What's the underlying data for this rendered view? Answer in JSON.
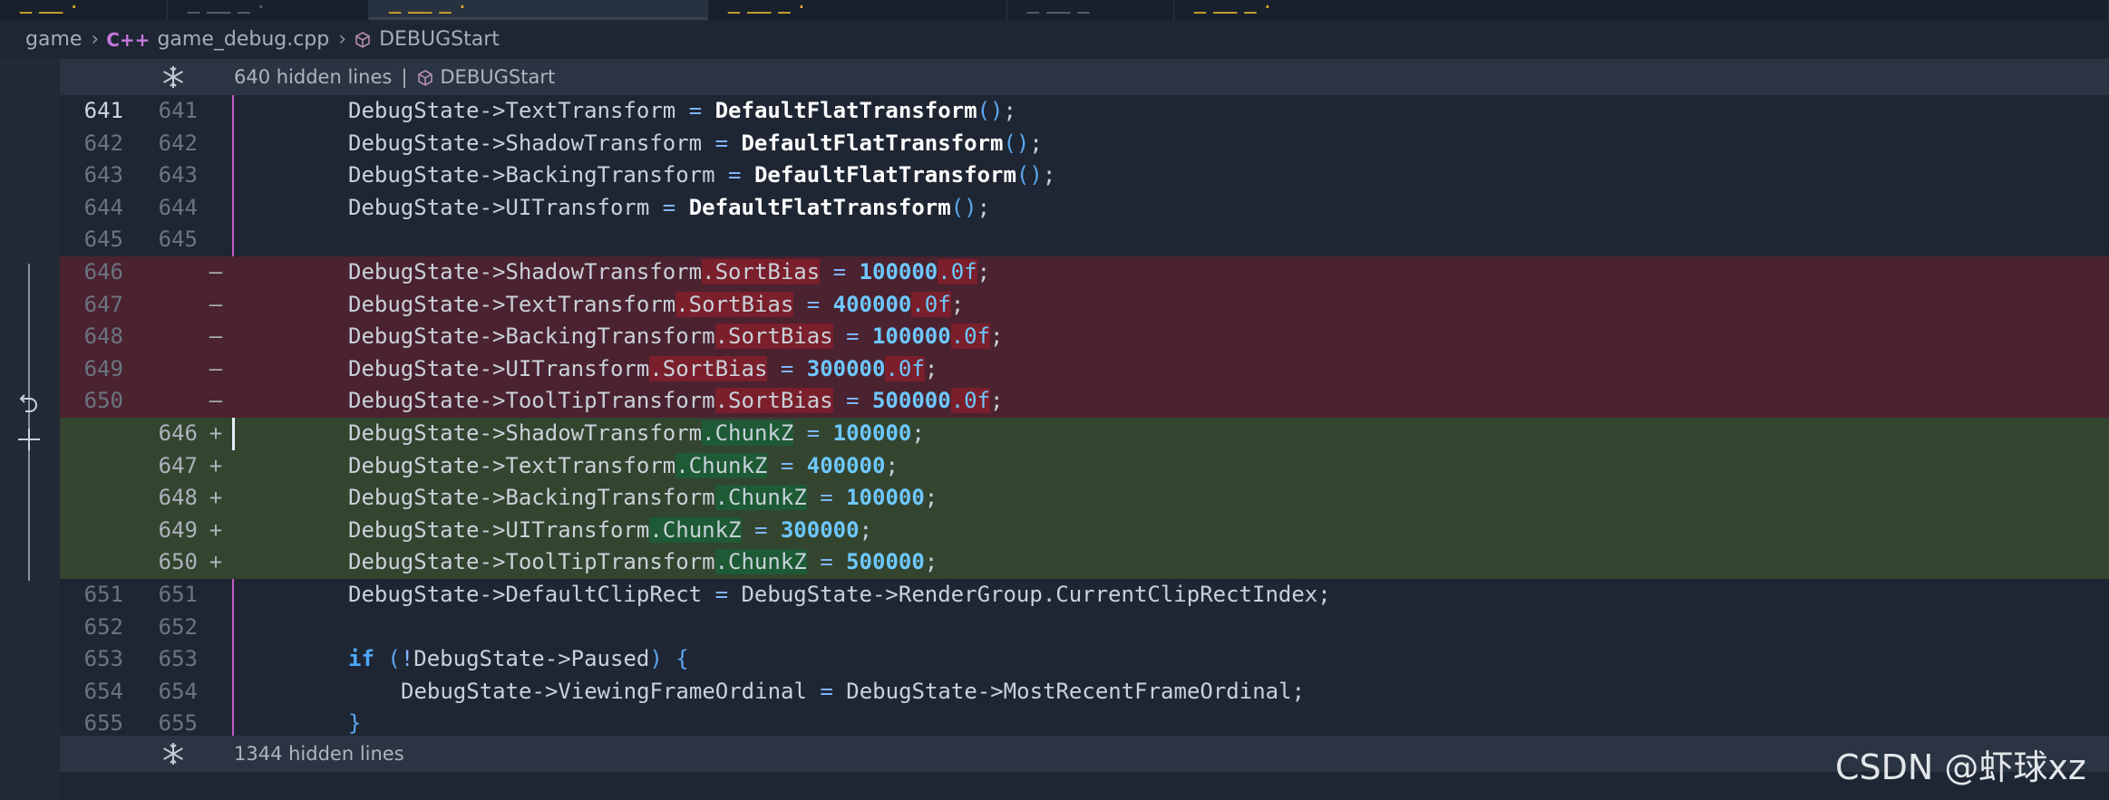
{
  "breadcrumb": {
    "folder": "game",
    "file_icon": "C++",
    "file": "game_debug.cpp",
    "symbol": "DEBUGStart"
  },
  "fold_top": {
    "hidden_text": "640 hidden lines",
    "separator": "|",
    "symbol": "DEBUGStart",
    "icon": "snowflake-icon"
  },
  "fold_bottom": {
    "hidden_text": "1344 hidden lines",
    "icon": "snowflake-icon"
  },
  "lines": [
    {
      "kind": "ctx",
      "old": "641",
      "new": "641",
      "current": true,
      "tokens": [
        [
          "DebugState->TextTransform ",
          "ident"
        ],
        [
          "=",
          "op"
        ],
        [
          " ",
          "ident"
        ],
        [
          "DefaultFlatTransform",
          "fn"
        ],
        [
          "()",
          "paren"
        ],
        [
          ";",
          "punct"
        ]
      ]
    },
    {
      "kind": "ctx",
      "old": "642",
      "new": "642",
      "tokens": [
        [
          "DebugState->ShadowTransform ",
          "ident"
        ],
        [
          "=",
          "op"
        ],
        [
          " ",
          "ident"
        ],
        [
          "DefaultFlatTransform",
          "fn"
        ],
        [
          "()",
          "paren"
        ],
        [
          ";",
          "punct"
        ]
      ]
    },
    {
      "kind": "ctx",
      "old": "643",
      "new": "643",
      "tokens": [
        [
          "DebugState->BackingTransform ",
          "ident"
        ],
        [
          "=",
          "op"
        ],
        [
          " ",
          "ident"
        ],
        [
          "DefaultFlatTransform",
          "fn"
        ],
        [
          "()",
          "paren"
        ],
        [
          ";",
          "punct"
        ]
      ]
    },
    {
      "kind": "ctx",
      "old": "644",
      "new": "644",
      "tokens": [
        [
          "DebugState->UITransform ",
          "ident"
        ],
        [
          "=",
          "op"
        ],
        [
          " ",
          "ident"
        ],
        [
          "DefaultFlatTransform",
          "fn"
        ],
        [
          "()",
          "paren"
        ],
        [
          ";",
          "punct"
        ]
      ]
    },
    {
      "kind": "ctx",
      "old": "645",
      "new": "645",
      "tokens": []
    },
    {
      "kind": "del",
      "old": "646",
      "marker": "—",
      "tokens": [
        [
          "DebugState->ShadowTransform",
          "ident"
        ],
        [
          ".SortBias",
          "ident",
          "hl-red"
        ],
        [
          " ",
          "ident"
        ],
        [
          "=",
          "op"
        ],
        [
          " ",
          "ident"
        ],
        [
          "100000",
          "num"
        ],
        [
          ".0f",
          "suffix",
          "hl-red"
        ],
        [
          ";",
          "punct"
        ]
      ]
    },
    {
      "kind": "del",
      "old": "647",
      "marker": "—",
      "tokens": [
        [
          "DebugState->TextTransform",
          "ident"
        ],
        [
          ".SortBias",
          "ident",
          "hl-red"
        ],
        [
          " ",
          "ident"
        ],
        [
          "=",
          "op"
        ],
        [
          " ",
          "ident"
        ],
        [
          "400000",
          "num"
        ],
        [
          ".0f",
          "suffix",
          "hl-red"
        ],
        [
          ";",
          "punct"
        ]
      ]
    },
    {
      "kind": "del",
      "old": "648",
      "marker": "—",
      "tokens": [
        [
          "DebugState->BackingTransform",
          "ident"
        ],
        [
          ".SortBias",
          "ident",
          "hl-red"
        ],
        [
          " ",
          "ident"
        ],
        [
          "=",
          "op"
        ],
        [
          " ",
          "ident"
        ],
        [
          "100000",
          "num"
        ],
        [
          ".0f",
          "suffix",
          "hl-red"
        ],
        [
          ";",
          "punct"
        ]
      ]
    },
    {
      "kind": "del",
      "old": "649",
      "marker": "—",
      "tokens": [
        [
          "DebugState->UITransform",
          "ident"
        ],
        [
          ".SortBias",
          "ident",
          "hl-red"
        ],
        [
          " ",
          "ident"
        ],
        [
          "=",
          "op"
        ],
        [
          " ",
          "ident"
        ],
        [
          "300000",
          "num"
        ],
        [
          ".0f",
          "suffix",
          "hl-red"
        ],
        [
          ";",
          "punct"
        ]
      ]
    },
    {
      "kind": "del",
      "old": "650",
      "marker": "—",
      "tokens": [
        [
          "DebugState->ToolTipTransform",
          "ident"
        ],
        [
          ".SortBias",
          "ident",
          "hl-red"
        ],
        [
          " ",
          "ident"
        ],
        [
          "=",
          "op"
        ],
        [
          " ",
          "ident"
        ],
        [
          "500000",
          "num"
        ],
        [
          ".0f",
          "suffix",
          "hl-red"
        ],
        [
          ";",
          "punct"
        ]
      ]
    },
    {
      "kind": "add",
      "new": "646",
      "marker": "+",
      "cursor": true,
      "tokens": [
        [
          "DebugState->ShadowTransform",
          "ident"
        ],
        [
          ".ChunkZ",
          "ident",
          "hl-green"
        ],
        [
          " ",
          "ident"
        ],
        [
          "=",
          "op"
        ],
        [
          " ",
          "ident"
        ],
        [
          "100000",
          "num"
        ],
        [
          ";",
          "punct"
        ]
      ]
    },
    {
      "kind": "add",
      "new": "647",
      "marker": "+",
      "tokens": [
        [
          "DebugState->TextTransform",
          "ident"
        ],
        [
          ".ChunkZ",
          "ident",
          "hl-green"
        ],
        [
          " ",
          "ident"
        ],
        [
          "=",
          "op"
        ],
        [
          " ",
          "ident"
        ],
        [
          "400000",
          "num"
        ],
        [
          ";",
          "punct"
        ]
      ]
    },
    {
      "kind": "add",
      "new": "648",
      "marker": "+",
      "tokens": [
        [
          "DebugState->BackingTransform",
          "ident"
        ],
        [
          ".ChunkZ",
          "ident",
          "hl-green"
        ],
        [
          " ",
          "ident"
        ],
        [
          "=",
          "op"
        ],
        [
          " ",
          "ident"
        ],
        [
          "100000",
          "num"
        ],
        [
          ";",
          "punct"
        ]
      ]
    },
    {
      "kind": "add",
      "new": "649",
      "marker": "+",
      "tokens": [
        [
          "DebugState->UITransform",
          "ident"
        ],
        [
          ".ChunkZ",
          "ident",
          "hl-green"
        ],
        [
          " ",
          "ident"
        ],
        [
          "=",
          "op"
        ],
        [
          " ",
          "ident"
        ],
        [
          "300000",
          "num"
        ],
        [
          ";",
          "punct"
        ]
      ]
    },
    {
      "kind": "add",
      "new": "650",
      "marker": "+",
      "tokens": [
        [
          "DebugState->ToolTipTransform",
          "ident"
        ],
        [
          ".ChunkZ",
          "ident",
          "hl-green"
        ],
        [
          " ",
          "ident"
        ],
        [
          "=",
          "op"
        ],
        [
          " ",
          "ident"
        ],
        [
          "500000",
          "num"
        ],
        [
          ";",
          "punct"
        ]
      ]
    },
    {
      "kind": "ctx",
      "old": "651",
      "new": "651",
      "tokens": [
        [
          "DebugState->DefaultClipRect ",
          "ident"
        ],
        [
          "=",
          "op"
        ],
        [
          " DebugState->RenderGroup.CurrentClipRectIndex",
          "ident"
        ],
        [
          ";",
          "punct"
        ]
      ]
    },
    {
      "kind": "ctx",
      "old": "652",
      "new": "652",
      "tokens": []
    },
    {
      "kind": "ctx",
      "old": "653",
      "new": "653",
      "tokens": [
        [
          "if",
          "kw"
        ],
        [
          " ",
          "ident"
        ],
        [
          "(",
          "paren"
        ],
        [
          "!",
          "op"
        ],
        [
          "DebugState->Paused",
          "ident"
        ],
        [
          ")",
          "paren"
        ],
        [
          " ",
          "ident"
        ],
        [
          "{",
          "paren"
        ]
      ]
    },
    {
      "kind": "ctx",
      "old": "654",
      "new": "654",
      "indent": true,
      "tokens": [
        [
          "DebugState->ViewingFrameOrdinal ",
          "ident"
        ],
        [
          "=",
          "op"
        ],
        [
          " DebugState->MostRecentFrameOrdinal",
          "ident"
        ],
        [
          ";",
          "punct"
        ]
      ]
    },
    {
      "kind": "ctx",
      "old": "655",
      "new": "655",
      "tokens": [
        [
          "}",
          "paren"
        ]
      ]
    }
  ],
  "watermark": "CSDN @虾球xz",
  "colors": {
    "removed_bg": "#4b2230",
    "added_bg": "#33442f",
    "change_bar": "#c35bc3",
    "accent_number": "#6ec8ff"
  }
}
